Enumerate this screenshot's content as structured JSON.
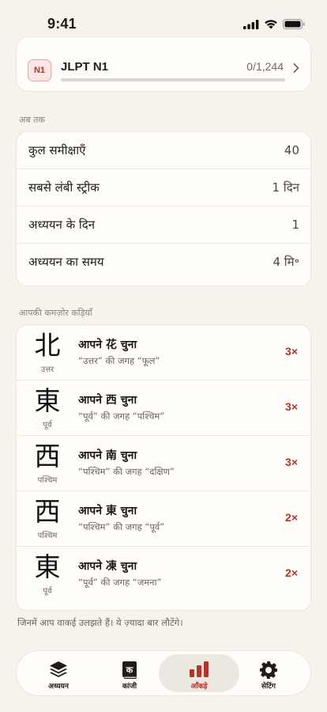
{
  "status": {
    "time": "9:41"
  },
  "jlpt": {
    "badge": "N1",
    "title": "JLPT N1",
    "count": "0/1,244",
    "progress": 0
  },
  "summary": {
    "section_label": "अब तक",
    "rows": [
      {
        "label": "कुल समीक्षाएँ",
        "value": "40"
      },
      {
        "label": "सबसे लंबी स्ट्रीक",
        "value": "1 दिन"
      },
      {
        "label": "अध्ययन के दिन",
        "value": "1"
      },
      {
        "label": "अध्ययन का समय",
        "value": "4 मि॰"
      }
    ]
  },
  "weak": {
    "section_label": "आपकी कमज़ोर कड़ियाँ",
    "items": [
      {
        "kanji": "北",
        "meaning": "उत्तर",
        "title": "आपने 花 चुना",
        "subtitle": "“उत्तर” की जगह “फूल”",
        "count": "3×"
      },
      {
        "kanji": "東",
        "meaning": "पूर्व",
        "title": "आपने 西 चुना",
        "subtitle": "“पूर्व” की जगह “पश्चिम”",
        "count": "3×"
      },
      {
        "kanji": "西",
        "meaning": "पश्चिम",
        "title": "आपने 南 चुना",
        "subtitle": "“पश्चिम” की जगह “दक्षिण”",
        "count": "3×"
      },
      {
        "kanji": "西",
        "meaning": "पश्चिम",
        "title": "आपने 東 चुना",
        "subtitle": "“पश्चिम” की जगह “पूर्व”",
        "count": "2×"
      },
      {
        "kanji": "東",
        "meaning": "पूर्व",
        "title": "आपने 凍 चुना",
        "subtitle": "“पूर्व” की जगह “जमना”",
        "count": "2×"
      }
    ],
    "footnote": "जिनमें आप वाकई उलझते हैं। ये ज़्यादा बार लौटेंगे।"
  },
  "tabs": [
    {
      "label": "अध्ययन",
      "icon": "stack-icon"
    },
    {
      "label": "कांजी",
      "icon": "book-icon",
      "glyph": "क"
    },
    {
      "label": "आँकड़े",
      "icon": "bar-chart-icon",
      "active": true
    },
    {
      "label": "सेटिंग",
      "icon": "gear-icon"
    }
  ],
  "colors": {
    "accent": "#b8322b",
    "background": "#f7f3ec",
    "card": "#fffdf9"
  }
}
